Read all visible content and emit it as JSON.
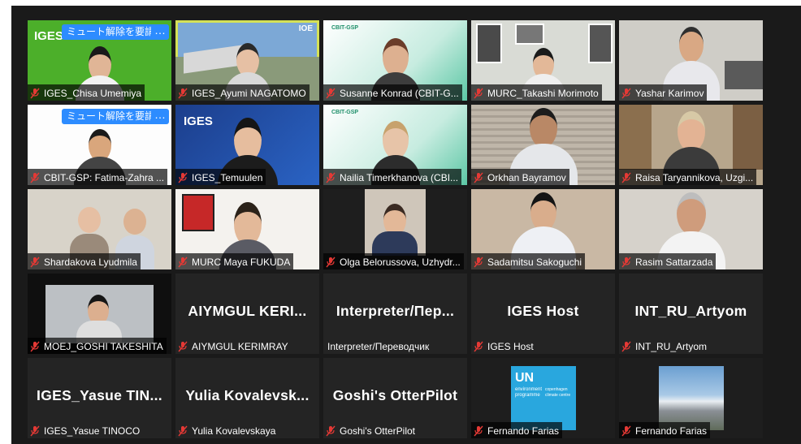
{
  "unmute_request_label": "ミュート解除を要請",
  "more_label": "…",
  "logos": {
    "iges": "IGES",
    "cbit": "CBIT-GSP",
    "un": "UN",
    "unep1": "environment",
    "unep2": "programme",
    "cph1": "copenhagen",
    "cph2": "climate centre",
    "ioe": "IOE"
  },
  "participants": [
    {
      "name": "IGES_Chisa Umemiya"
    },
    {
      "name": "IGES_Ayumi NAGATOMO"
    },
    {
      "name": "Susanne Konrad (CBIT-G..."
    },
    {
      "name": "MURC_Takashi Morimoto"
    },
    {
      "name": "Yashar Karimov"
    },
    {
      "name": "CBIT-GSP: Fatima-Zahra ..."
    },
    {
      "name": "IGES_Temuulen"
    },
    {
      "name": "Nailia Timerkhanova (CBI..."
    },
    {
      "name": "Orkhan Bayramov"
    },
    {
      "name": "Raisa Taryannikova, Uzgi..."
    },
    {
      "name": "Shardakova Lyudmila"
    },
    {
      "name": "MURC Maya FUKUDA"
    },
    {
      "name": "Olga Belorussova, Uzhydr..."
    },
    {
      "name": "Sadamitsu Sakoguchi"
    },
    {
      "name": "Rasim Sattarzada"
    },
    {
      "name": "MOEJ_GOSHI TAKESHITA"
    },
    {
      "name": "AIYMGUL KERIMRAY",
      "display": "AIYMGUL  KERI..."
    },
    {
      "name": "Interpreter/Переводчик",
      "display": "Interpreter/Пер..."
    },
    {
      "name": "IGES Host",
      "display": "IGES Host"
    },
    {
      "name": "INT_RU_Artyom",
      "display": "INT_RU_Artyom"
    },
    {
      "name": "IGES_Yasue TINOCO",
      "display": "IGES_Yasue  TIN..."
    },
    {
      "name": "Yulia Kovalevskaya",
      "display": "Yulia  Kovalevsk..."
    },
    {
      "name": "Goshi's OtterPilot",
      "display": "Goshi's OtterPilot"
    },
    {
      "name": "Fernando Farias"
    },
    {
      "name": "Fernando Farias"
    }
  ]
}
